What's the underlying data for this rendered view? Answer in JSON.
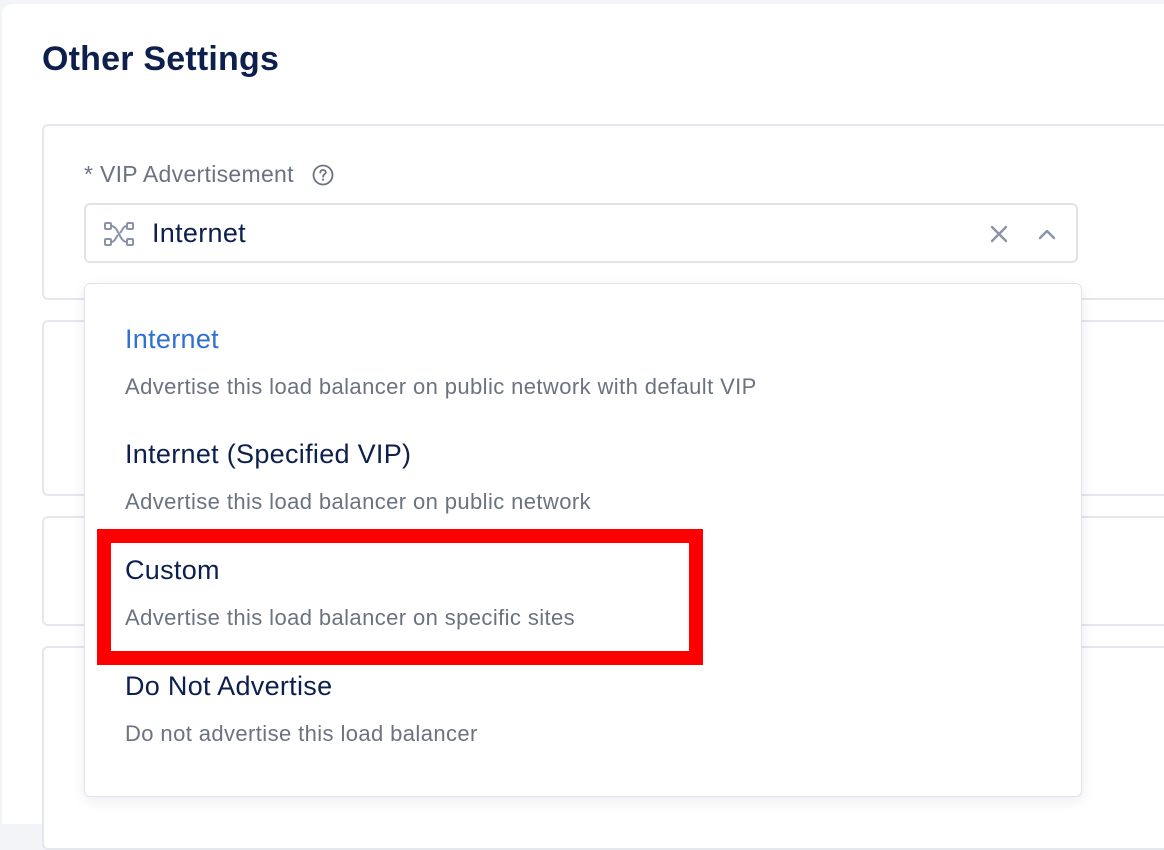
{
  "section": {
    "title": "Other Settings"
  },
  "vip_field": {
    "label": "* VIP Advertisement",
    "selected_value": "Internet",
    "icons": {
      "help": "question-circle-icon",
      "value": "network-route-icon",
      "clear": "close-icon",
      "toggle": "chevron-up-icon"
    }
  },
  "dropdown": {
    "options": [
      {
        "title": "Internet",
        "description": "Advertise this load balancer on public network with default VIP",
        "selected": true
      },
      {
        "title": "Internet (Specified VIP)",
        "description": "Advertise this load balancer on public network",
        "selected": false
      },
      {
        "title": "Custom",
        "description": "Advertise this load balancer on specific sites",
        "selected": false
      },
      {
        "title": "Do Not Advertise",
        "description": "Do not advertise this load balancer",
        "selected": false
      }
    ]
  },
  "colors": {
    "heading": "#0c1f4d",
    "selected_option": "#2f6fd6",
    "muted_text": "#6b7280",
    "highlight": "#ff0000"
  }
}
